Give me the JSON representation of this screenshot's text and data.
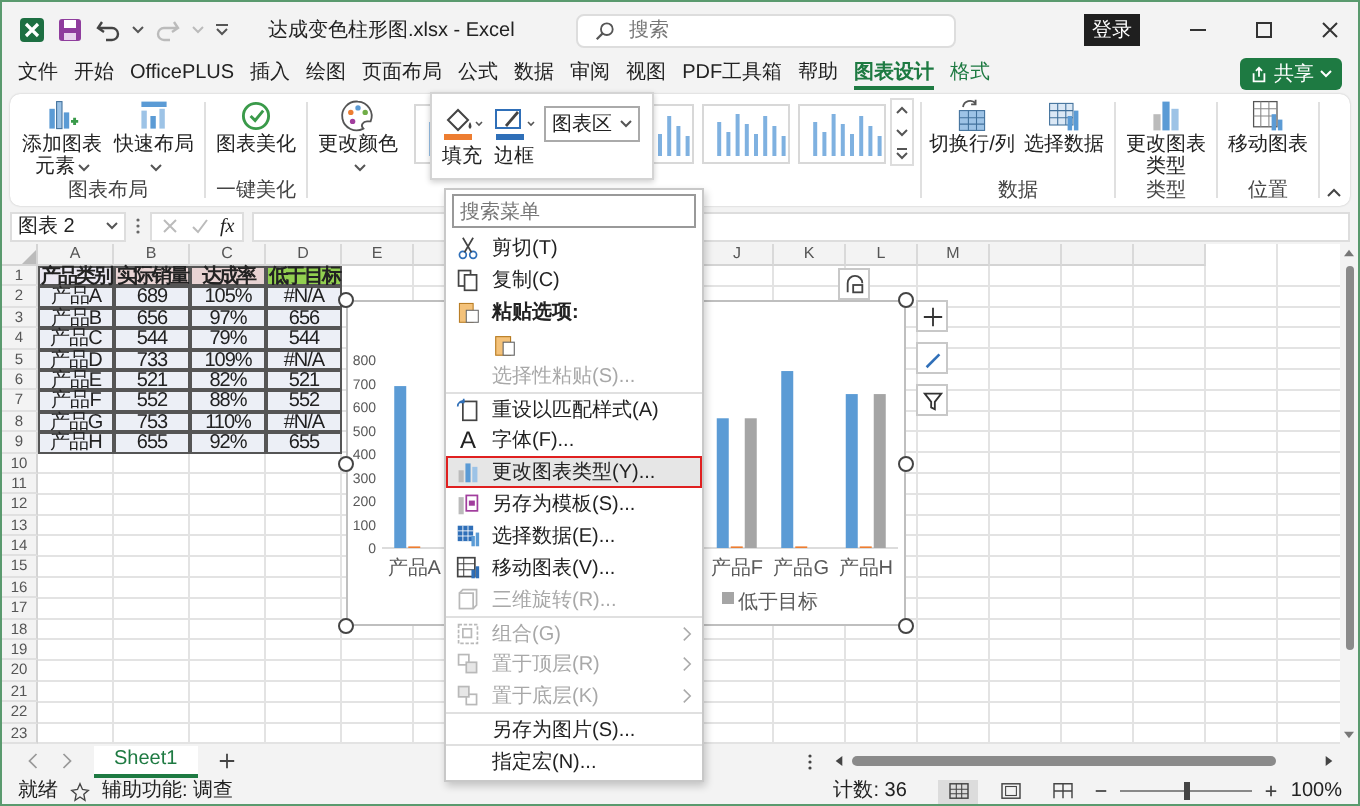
{
  "window": {
    "title": "达成变色柱形图.xlsx - Excel",
    "search_placeholder": "搜索",
    "sign_in": "登录"
  },
  "menu_tabs": [
    {
      "label": "文件",
      "selected": false,
      "contextual": false
    },
    {
      "label": "开始",
      "selected": false,
      "contextual": false
    },
    {
      "label": "OfficePLUS",
      "selected": false,
      "contextual": false
    },
    {
      "label": "插入",
      "selected": false,
      "contextual": false
    },
    {
      "label": "绘图",
      "selected": false,
      "contextual": false
    },
    {
      "label": "页面布局",
      "selected": false,
      "contextual": false
    },
    {
      "label": "公式",
      "selected": false,
      "contextual": false
    },
    {
      "label": "数据",
      "selected": false,
      "contextual": false
    },
    {
      "label": "审阅",
      "selected": false,
      "contextual": false
    },
    {
      "label": "视图",
      "selected": false,
      "contextual": false
    },
    {
      "label": "PDF工具箱",
      "selected": false,
      "contextual": false
    },
    {
      "label": "帮助",
      "selected": false,
      "contextual": false
    },
    {
      "label": "图表设计",
      "selected": true,
      "contextual": true
    },
    {
      "label": "格式",
      "selected": false,
      "contextual": true
    }
  ],
  "share_button": "共享",
  "ribbon_groups": [
    {
      "label": "图表布局",
      "buttons": [
        {
          "kind": "add_element",
          "label": "添加图表元素",
          "dropdown": true
        },
        {
          "kind": "quick_layout",
          "label": "快速布局",
          "dropdown": true
        }
      ]
    },
    {
      "label": "一键美化",
      "buttons": [
        {
          "kind": "beautify",
          "label": "图表美化",
          "dropdown": false
        }
      ]
    },
    {
      "buttons": [
        {
          "kind": "colors",
          "label": "更改颜色",
          "dropdown": true
        }
      ],
      "gallery": true
    },
    {
      "label": "数据",
      "buttons": [
        {
          "kind": "switch",
          "label": "切换行/列",
          "dropdown": false
        },
        {
          "kind": "select_data",
          "label": "选择数据",
          "dropdown": false
        }
      ]
    },
    {
      "label": "类型",
      "buttons": [
        {
          "kind": "chart_type",
          "label": "更改图表类型",
          "dropdown": false
        }
      ]
    },
    {
      "label": "位置",
      "buttons": [
        {
          "kind": "move",
          "label": "移动图表",
          "dropdown": false
        }
      ]
    }
  ],
  "mini_toolbar": {
    "fill": "填充",
    "border": "边框",
    "element": "图表区"
  },
  "formula_bar": {
    "name_box": "图表 2",
    "fx": "fx"
  },
  "sheet": {
    "columns_left": [
      "A",
      "B",
      "C",
      "D",
      "E"
    ],
    "columns_right": [
      "J",
      "K",
      "L",
      "M"
    ],
    "row_numbers": [
      "1",
      "2",
      "3",
      "4",
      "5",
      "6",
      "7",
      "8",
      "9",
      "10",
      "11",
      "12",
      "13",
      "14",
      "15",
      "16",
      "17",
      "18",
      "19",
      "20",
      "21",
      "22",
      "23"
    ],
    "header": [
      {
        "text": "产品类别",
        "color": "#ece9f3"
      },
      {
        "text": "实际销量",
        "color": "#e8d3d3"
      },
      {
        "text": "达成率",
        "color": "#e8d3d3"
      },
      {
        "text": "低于目标",
        "color": "#92d050"
      }
    ],
    "rows": [
      [
        "产品A",
        "689",
        "105%",
        "#N/A"
      ],
      [
        "产品B",
        "656",
        "97%",
        "656"
      ],
      [
        "产品C",
        "544",
        "79%",
        "544"
      ],
      [
        "产品D",
        "733",
        "109%",
        "#N/A"
      ],
      [
        "产品E",
        "521",
        "82%",
        "521"
      ],
      [
        "产品F",
        "552",
        "88%",
        "552"
      ],
      [
        "产品G",
        "753",
        "110%",
        "#N/A"
      ],
      [
        "产品H",
        "655",
        "92%",
        "655"
      ]
    ]
  },
  "chart": {
    "chart_data": {
      "type": "bar",
      "categories": [
        "产品A",
        null,
        null,
        null,
        null,
        "产品F",
        "产品G",
        "产品H"
      ],
      "series": [
        {
          "color": "#5b9bd5",
          "values": [
            689,
            null,
            null,
            null,
            null,
            552,
            753,
            655
          ]
        },
        {
          "color": "#ed7d31",
          "values": [
            1.05,
            null,
            null,
            null,
            null,
            0.88,
            1.1,
            0.92
          ]
        },
        {
          "name": "低于目标",
          "color": "#a5a5a5",
          "values": [
            null,
            null,
            null,
            null,
            null,
            552,
            null,
            655
          ]
        }
      ],
      "ylim": [
        0,
        800
      ],
      "yticks": [
        0,
        100,
        200,
        300,
        400,
        500,
        600,
        700,
        800
      ]
    }
  },
  "context_menu": {
    "search_placeholder": "搜索菜单",
    "items": [
      {
        "kind": "item",
        "label": "剪切(T)",
        "disabled": false,
        "submenu": false,
        "divider": false,
        "highlighted": false
      },
      {
        "kind": "item",
        "label": "复制(C)",
        "disabled": false,
        "submenu": false,
        "divider": false,
        "highlighted": false
      },
      {
        "kind": "header",
        "label": "粘贴选项:",
        "disabled": false,
        "submenu": false,
        "divider": false,
        "highlighted": false
      },
      {
        "kind": "paste_options",
        "divider": false
      },
      {
        "kind": "item",
        "label": "选择性粘贴(S)...",
        "disabled": true,
        "submenu": false,
        "divider": false,
        "highlighted": false
      },
      {
        "kind": "item",
        "label": "重设以匹配样式(A)",
        "disabled": false,
        "submenu": false,
        "divider": true,
        "highlighted": false
      },
      {
        "kind": "item",
        "glyph": "A",
        "label": "字体(F)...",
        "disabled": false,
        "submenu": false,
        "divider": false,
        "highlighted": false
      },
      {
        "kind": "item",
        "label": "更改图表类型(Y)...",
        "disabled": false,
        "submenu": false,
        "divider": false,
        "highlighted": true
      },
      {
        "kind": "item",
        "label": "另存为模板(S)...",
        "disabled": false,
        "submenu": false,
        "divider": false,
        "highlighted": false
      },
      {
        "kind": "item",
        "label": "选择数据(E)...",
        "disabled": false,
        "submenu": false,
        "divider": false,
        "highlighted": false
      },
      {
        "kind": "item",
        "label": "移动图表(V)...",
        "disabled": false,
        "submenu": false,
        "divider": false,
        "highlighted": false
      },
      {
        "kind": "item",
        "label": "三维旋转(R)...",
        "disabled": true,
        "submenu": false,
        "divider": false,
        "highlighted": false
      },
      {
        "kind": "item",
        "label": "组合(G)",
        "disabled": true,
        "submenu": true,
        "divider": true,
        "highlighted": false
      },
      {
        "kind": "item",
        "label": "置于顶层(R)",
        "disabled": true,
        "submenu": true,
        "divider": false,
        "highlighted": false
      },
      {
        "kind": "item",
        "label": "置于底层(K)",
        "disabled": true,
        "submenu": true,
        "divider": false,
        "highlighted": false
      },
      {
        "kind": "item",
        "label": "另存为图片(S)...",
        "disabled": false,
        "submenu": false,
        "divider": true,
        "highlighted": false
      },
      {
        "kind": "item",
        "label": "指定宏(N)...",
        "disabled": false,
        "submenu": false,
        "divider": true,
        "highlighted": false
      }
    ]
  },
  "sheet_tabs": [
    {
      "label": "Sheet1",
      "selected": true
    }
  ],
  "status_bar": {
    "ready": "就绪",
    "accessibility": "辅助功能: 调查",
    "count": "计数: 36",
    "views": [
      {
        "selected": true
      },
      {
        "selected": false
      },
      {
        "selected": false
      }
    ],
    "zoom": {
      "level": 0.5,
      "reading": "100%"
    }
  }
}
